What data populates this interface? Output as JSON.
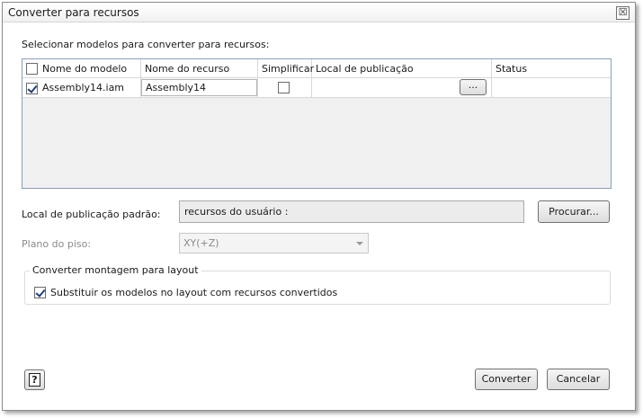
{
  "window": {
    "title": "Converter para recursos",
    "close_glyph": "☒"
  },
  "intro_label": "Selecionar modelos para converter para recursos:",
  "grid": {
    "columns": [
      "Nome do modelo",
      "Nome do recurso",
      "Simplificar",
      "Local de publicação",
      "Status"
    ],
    "header_checked": false,
    "rows": [
      {
        "checked": true,
        "model_name": "Assembly14.iam",
        "resource_name": "Assembly14",
        "simplify": false,
        "publish_button": "...",
        "status": ""
      }
    ]
  },
  "publish_location": {
    "label": "Local de publicação padrão:",
    "value": "recursos do usuário :",
    "browse_button": "Procurar..."
  },
  "floor_plane": {
    "label": "Plano do piso:",
    "value": "XY(+Z)",
    "enabled": false
  },
  "layout_group": {
    "legend": "Converter montagem para layout",
    "replace_checkbox_label": "Substituir os modelos no layout com recursos convertidos",
    "replace_checked": true
  },
  "footer": {
    "help_icon": "question-mark-icon",
    "help_glyph": "?",
    "convert_button": "Converter",
    "cancel_button": "Cancelar"
  },
  "colors": {
    "grid_border": "#8a9fb8",
    "checkmark": "#1f3f7a",
    "disabled_text": "#8a8a8a"
  }
}
